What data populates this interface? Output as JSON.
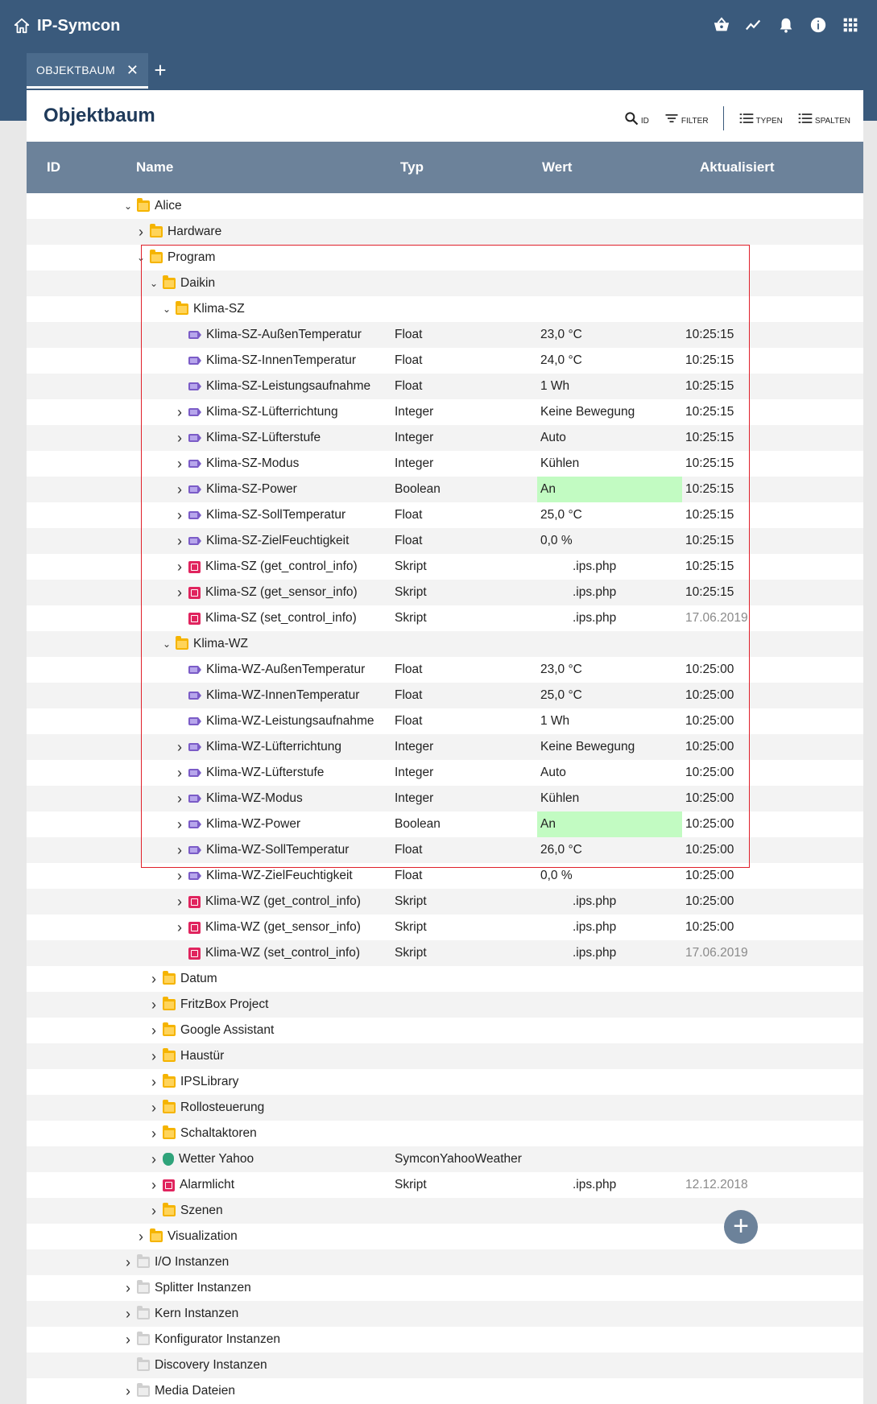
{
  "app": {
    "title": "IP-Symcon"
  },
  "tabs": [
    {
      "label": "OBJEKTBAUM"
    }
  ],
  "panel": {
    "title": "Objektbaum"
  },
  "actions": [
    {
      "icon": "search-icon",
      "label": "ID"
    },
    {
      "icon": "filter-icon",
      "label": "FILTER"
    },
    {
      "icon": "list-icon",
      "label": "TYPEN"
    },
    {
      "icon": "list-icon",
      "label": "SPALTEN"
    }
  ],
  "columns": {
    "id": "ID",
    "name": "Name",
    "type": "Typ",
    "value": "Wert",
    "updated": "Aktualisiert"
  },
  "rows": [
    {
      "level": 0,
      "chevron": "down",
      "icon": "folder",
      "name": "Alice",
      "type": "",
      "value": "",
      "updated": ""
    },
    {
      "level": 1,
      "chevron": "right",
      "icon": "folder",
      "name": "Hardware",
      "type": "",
      "value": "",
      "updated": ""
    },
    {
      "level": 1,
      "chevron": "down",
      "icon": "folder",
      "name": "Program",
      "type": "",
      "value": "",
      "updated": ""
    },
    {
      "level": 2,
      "chevron": "down",
      "icon": "folder",
      "name": "Daikin",
      "type": "",
      "value": "",
      "updated": ""
    },
    {
      "level": 3,
      "chevron": "down",
      "icon": "folder",
      "name": "Klima-SZ",
      "type": "",
      "value": "",
      "updated": ""
    },
    {
      "level": 4,
      "chevron": "",
      "icon": "variable",
      "name": "Klima-SZ-AußenTemperatur",
      "type": "Float",
      "value": "23,0 °C",
      "updated": "10:25:15"
    },
    {
      "level": 4,
      "chevron": "",
      "icon": "variable",
      "name": "Klima-SZ-InnenTemperatur",
      "type": "Float",
      "value": "24,0 °C",
      "updated": "10:25:15"
    },
    {
      "level": 4,
      "chevron": "",
      "icon": "variable",
      "name": "Klima-SZ-Leistungsaufnahme",
      "type": "Float",
      "value": "1 Wh",
      "updated": "10:25:15"
    },
    {
      "level": 4,
      "chevron": "right",
      "icon": "variable",
      "name": "Klima-SZ-Lüfterrichtung",
      "type": "Integer",
      "value": "Keine Bewegung",
      "updated": "10:25:15"
    },
    {
      "level": 4,
      "chevron": "right",
      "icon": "variable",
      "name": "Klima-SZ-Lüfterstufe",
      "type": "Integer",
      "value": "Auto",
      "updated": "10:25:15"
    },
    {
      "level": 4,
      "chevron": "right",
      "icon": "variable",
      "name": "Klima-SZ-Modus",
      "type": "Integer",
      "value": "Kühlen",
      "updated": "10:25:15"
    },
    {
      "level": 4,
      "chevron": "right",
      "icon": "variable",
      "name": "Klima-SZ-Power",
      "type": "Boolean",
      "value": "An",
      "updated": "10:25:15",
      "highlight": "#c2fbc2"
    },
    {
      "level": 4,
      "chevron": "right",
      "icon": "variable",
      "name": "Klima-SZ-SollTemperatur",
      "type": "Float",
      "value": "25,0 °C",
      "updated": "10:25:15"
    },
    {
      "level": 4,
      "chevron": "right",
      "icon": "variable",
      "name": "Klima-SZ-ZielFeuchtigkeit",
      "type": "Float",
      "value": "0,0 %",
      "updated": "10:25:15"
    },
    {
      "level": 4,
      "chevron": "right",
      "icon": "script",
      "name": "Klima-SZ (get_control_info)",
      "type": "Skript",
      "value": ".ips.php",
      "updated": "10:25:15"
    },
    {
      "level": 4,
      "chevron": "right",
      "icon": "script",
      "name": "Klima-SZ (get_sensor_info)",
      "type": "Skript",
      "value": ".ips.php",
      "updated": "10:25:15"
    },
    {
      "level": 4,
      "chevron": "",
      "icon": "script",
      "name": "Klima-SZ (set_control_info)",
      "type": "Skript",
      "value": ".ips.php",
      "updated": "17.06.2019",
      "dim": true
    },
    {
      "level": 3,
      "chevron": "down",
      "icon": "folder",
      "name": "Klima-WZ",
      "type": "",
      "value": "",
      "updated": ""
    },
    {
      "level": 4,
      "chevron": "",
      "icon": "variable",
      "name": "Klima-WZ-AußenTemperatur",
      "type": "Float",
      "value": "23,0 °C",
      "updated": "10:25:00"
    },
    {
      "level": 4,
      "chevron": "",
      "icon": "variable",
      "name": "Klima-WZ-InnenTemperatur",
      "type": "Float",
      "value": "25,0 °C",
      "updated": "10:25:00"
    },
    {
      "level": 4,
      "chevron": "",
      "icon": "variable",
      "name": "Klima-WZ-Leistungsaufnahme",
      "type": "Float",
      "value": "1 Wh",
      "updated": "10:25:00"
    },
    {
      "level": 4,
      "chevron": "right",
      "icon": "variable",
      "name": "Klima-WZ-Lüfterrichtung",
      "type": "Integer",
      "value": "Keine Bewegung",
      "updated": "10:25:00"
    },
    {
      "level": 4,
      "chevron": "right",
      "icon": "variable",
      "name": "Klima-WZ-Lüfterstufe",
      "type": "Integer",
      "value": "Auto",
      "updated": "10:25:00"
    },
    {
      "level": 4,
      "chevron": "right",
      "icon": "variable",
      "name": "Klima-WZ-Modus",
      "type": "Integer",
      "value": "Kühlen",
      "updated": "10:25:00"
    },
    {
      "level": 4,
      "chevron": "right",
      "icon": "variable",
      "name": "Klima-WZ-Power",
      "type": "Boolean",
      "value": "An",
      "updated": "10:25:00",
      "highlight": "#c2fbc2"
    },
    {
      "level": 4,
      "chevron": "right",
      "icon": "variable",
      "name": "Klima-WZ-SollTemperatur",
      "type": "Float",
      "value": "26,0 °C",
      "updated": "10:25:00"
    },
    {
      "level": 4,
      "chevron": "right",
      "icon": "variable",
      "name": "Klima-WZ-ZielFeuchtigkeit",
      "type": "Float",
      "value": "0,0 %",
      "updated": "10:25:00"
    },
    {
      "level": 4,
      "chevron": "right",
      "icon": "script",
      "name": "Klima-WZ (get_control_info)",
      "type": "Skript",
      "value": ".ips.php",
      "updated": "10:25:00"
    },
    {
      "level": 4,
      "chevron": "right",
      "icon": "script",
      "name": "Klima-WZ (get_sensor_info)",
      "type": "Skript",
      "value": ".ips.php",
      "updated": "10:25:00"
    },
    {
      "level": 4,
      "chevron": "",
      "icon": "script",
      "name": "Klima-WZ (set_control_info)",
      "type": "Skript",
      "value": ".ips.php",
      "updated": "17.06.2019",
      "dim": true
    },
    {
      "level": 2,
      "chevron": "right",
      "icon": "folder",
      "name": "Datum",
      "type": "",
      "value": "",
      "updated": ""
    },
    {
      "level": 2,
      "chevron": "right",
      "icon": "folder",
      "name": "FritzBox Project",
      "type": "",
      "value": "",
      "updated": ""
    },
    {
      "level": 2,
      "chevron": "right",
      "icon": "folder",
      "name": "Google Assistant",
      "type": "",
      "value": "",
      "updated": ""
    },
    {
      "level": 2,
      "chevron": "right",
      "icon": "folder",
      "name": "Haustür",
      "type": "",
      "value": "",
      "updated": ""
    },
    {
      "level": 2,
      "chevron": "right",
      "icon": "folder",
      "name": "IPSLibrary",
      "type": "",
      "value": "",
      "updated": ""
    },
    {
      "level": 2,
      "chevron": "right",
      "icon": "folder",
      "name": "Rollosteuerung",
      "type": "",
      "value": "",
      "updated": ""
    },
    {
      "level": 2,
      "chevron": "right",
      "icon": "folder",
      "name": "Schaltaktoren",
      "type": "",
      "value": "",
      "updated": ""
    },
    {
      "level": 2,
      "chevron": "right",
      "icon": "module",
      "name": "Wetter Yahoo",
      "type": "SymconYahooWeather",
      "value": "",
      "updated": ""
    },
    {
      "level": 2,
      "chevron": "right",
      "icon": "script",
      "name": "Alarmlicht",
      "type": "Skript",
      "value": ".ips.php",
      "updated": "12.12.2018",
      "dim": true
    },
    {
      "level": 2,
      "chevron": "right",
      "icon": "folder",
      "name": "Szenen",
      "type": "",
      "value": "",
      "updated": ""
    },
    {
      "level": 1,
      "chevron": "right",
      "icon": "folder",
      "name": "Visualization",
      "type": "",
      "value": "",
      "updated": ""
    },
    {
      "level": 0,
      "chevron": "right",
      "icon": "gray-folder",
      "name": "I/O Instanzen",
      "type": "",
      "value": "",
      "updated": ""
    },
    {
      "level": 0,
      "chevron": "right",
      "icon": "gray-folder",
      "name": "Splitter Instanzen",
      "type": "",
      "value": "",
      "updated": ""
    },
    {
      "level": 0,
      "chevron": "right",
      "icon": "gray-folder",
      "name": "Kern Instanzen",
      "type": "",
      "value": "",
      "updated": ""
    },
    {
      "level": 0,
      "chevron": "right",
      "icon": "gray-folder",
      "name": "Konfigurator Instanzen",
      "type": "",
      "value": "",
      "updated": ""
    },
    {
      "level": 0,
      "chevron": "",
      "icon": "gray-folder",
      "name": "Discovery Instanzen",
      "type": "",
      "value": "",
      "updated": ""
    },
    {
      "level": 0,
      "chevron": "right",
      "icon": "gray-folder",
      "name": "Media Dateien",
      "type": "",
      "value": "",
      "updated": ""
    }
  ],
  "colors": {
    "header": "#3a5a7c",
    "table_head": "#6c829a",
    "highlight": "#c2fbc2",
    "selection_box": "#e0202a"
  }
}
